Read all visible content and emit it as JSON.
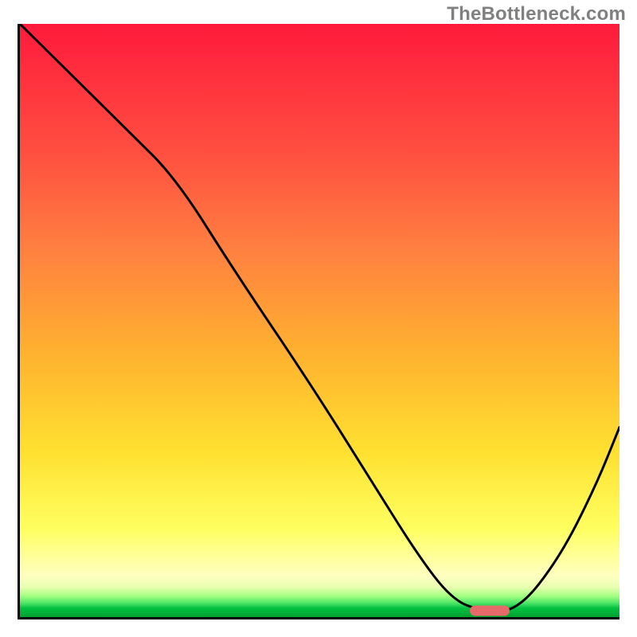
{
  "watermark": "TheBottleneck.com",
  "chart_data": {
    "type": "line",
    "title": "",
    "xlabel": "",
    "ylabel": "",
    "xlim": [
      0,
      100
    ],
    "ylim": [
      0,
      100
    ],
    "series": [
      {
        "name": "curve",
        "x": [
          0,
          5,
          18,
          26,
          36,
          48,
          58,
          66,
          72,
          77,
          83,
          90,
          96,
          100
        ],
        "y": [
          100,
          95,
          82,
          74,
          58,
          40,
          24,
          11,
          3,
          1,
          1,
          10,
          22,
          32
        ]
      }
    ],
    "marker": {
      "x": 78,
      "y": 1.5
    },
    "gradient_stops": [
      {
        "pos": 0.0,
        "color": "#ff1a3c"
      },
      {
        "pos": 0.22,
        "color": "#ff5040"
      },
      {
        "pos": 0.55,
        "color": "#ffb030"
      },
      {
        "pos": 0.85,
        "color": "#ffff60"
      },
      {
        "pos": 0.97,
        "color": "#40e060"
      },
      {
        "pos": 1.0,
        "color": "#00a030"
      }
    ]
  }
}
